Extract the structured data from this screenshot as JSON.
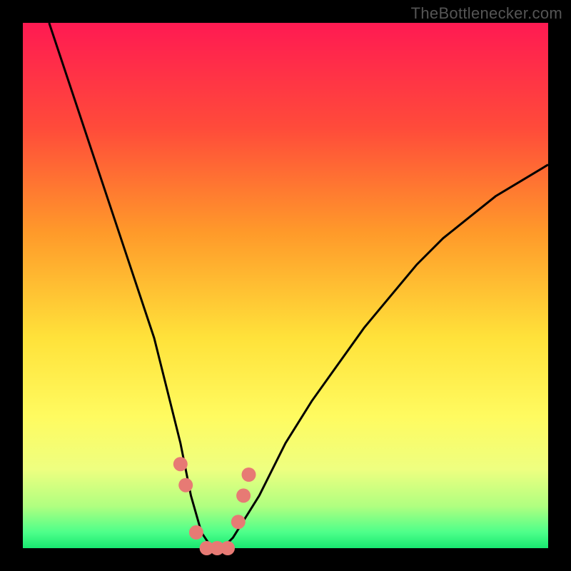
{
  "attribution": "TheBottlenecker.com",
  "chart_data": {
    "type": "line",
    "title": "",
    "xlabel": "",
    "ylabel": "",
    "xlim": [
      0,
      100
    ],
    "ylim": [
      0,
      100
    ],
    "series": [
      {
        "name": "bottleneck-curve",
        "x": [
          5,
          10,
          15,
          20,
          25,
          28,
          30,
          32,
          34,
          36,
          38,
          40,
          45,
          50,
          55,
          60,
          65,
          70,
          75,
          80,
          85,
          90,
          95,
          100
        ],
        "y": [
          100,
          85,
          70,
          55,
          40,
          28,
          20,
          10,
          3,
          0,
          0,
          2,
          10,
          20,
          28,
          35,
          42,
          48,
          54,
          59,
          63,
          67,
          70,
          73
        ]
      }
    ],
    "markers": {
      "name": "highlight-points",
      "x": [
        30,
        31,
        33,
        35,
        37,
        39,
        41,
        42,
        43
      ],
      "y": [
        16,
        12,
        3,
        0,
        0,
        0,
        5,
        10,
        14
      ]
    },
    "gradient_stops": [
      {
        "offset": 0,
        "color": "#ff1a52"
      },
      {
        "offset": 20,
        "color": "#ff4b3a"
      },
      {
        "offset": 40,
        "color": "#ff9a2a"
      },
      {
        "offset": 60,
        "color": "#ffe23a"
      },
      {
        "offset": 75,
        "color": "#fffb60"
      },
      {
        "offset": 85,
        "color": "#eeff80"
      },
      {
        "offset": 92,
        "color": "#b0ff80"
      },
      {
        "offset": 97,
        "color": "#4dff8a"
      },
      {
        "offset": 100,
        "color": "#18e870"
      }
    ],
    "marker_color": "#e77a74",
    "curve_color": "#000000"
  }
}
